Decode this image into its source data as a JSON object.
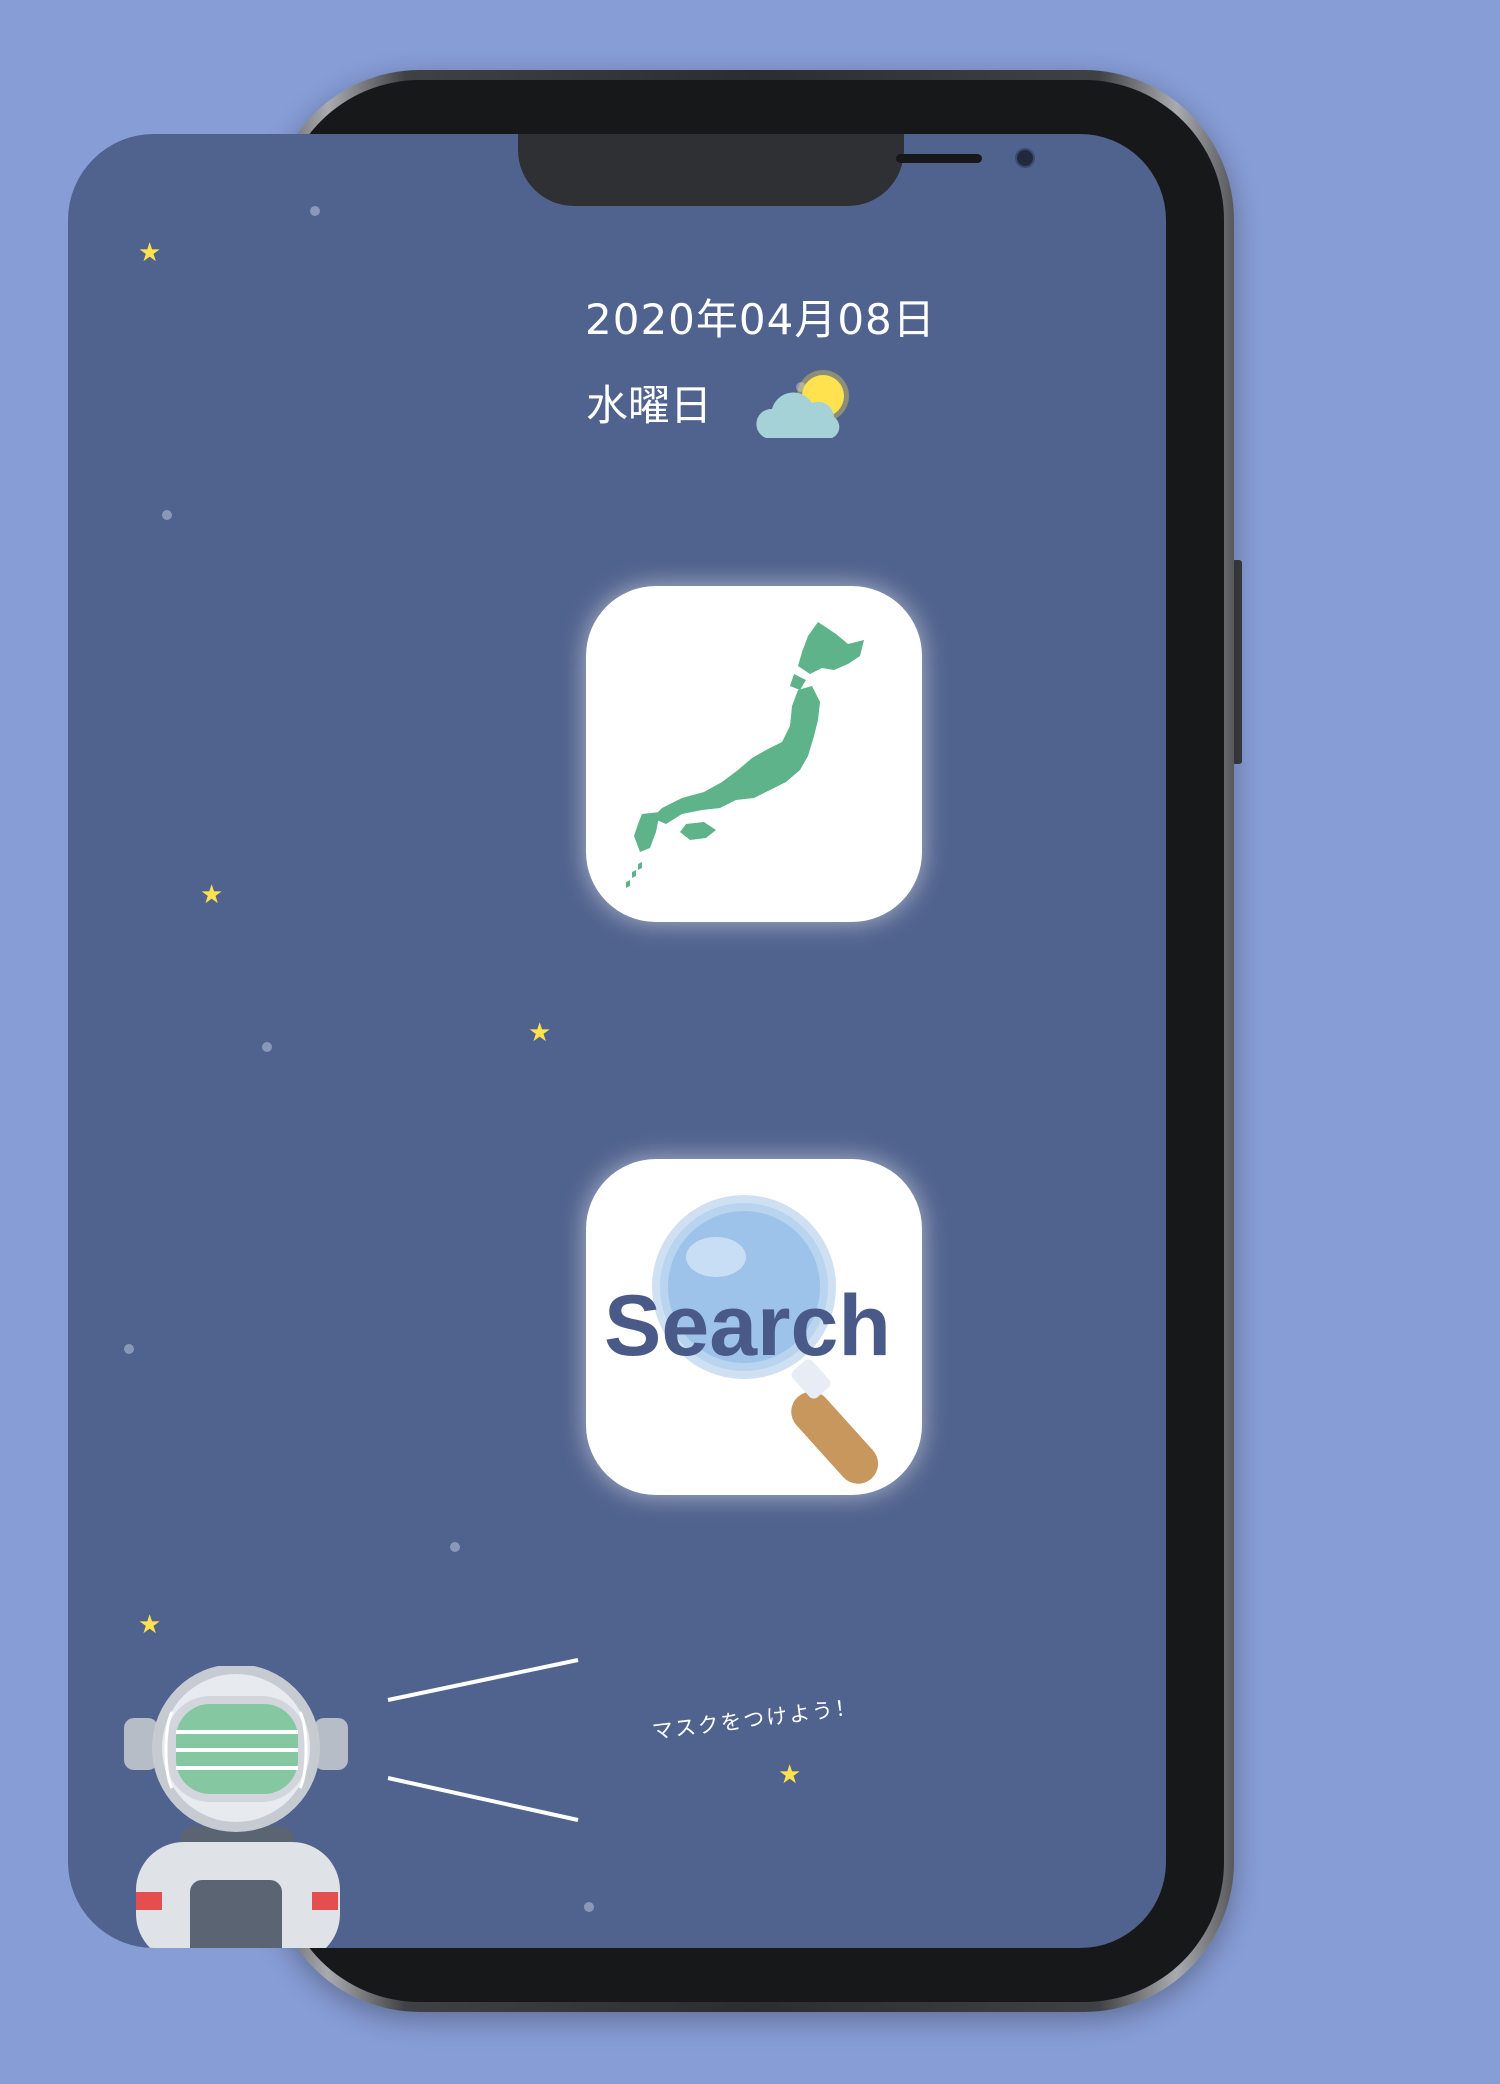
{
  "header": {
    "date": "2020年04月08日",
    "weekday": "水曜日",
    "weather_icon": "partly-cloudy-icon"
  },
  "apps": [
    {
      "name": "japan-map-app",
      "icon": "japan-map-icon",
      "color": "#5fb38a"
    },
    {
      "name": "search-app",
      "label": "Search",
      "icon": "magnifying-glass-icon",
      "color": "#4a5a88"
    }
  ],
  "mascot": {
    "speech": "マスクをつけよう！",
    "icon": "astronaut-with-mask-icon"
  },
  "colors": {
    "background": "#879dd6",
    "screen": "#50628e",
    "star": "#ffe24d",
    "tile": "#ffffff"
  }
}
